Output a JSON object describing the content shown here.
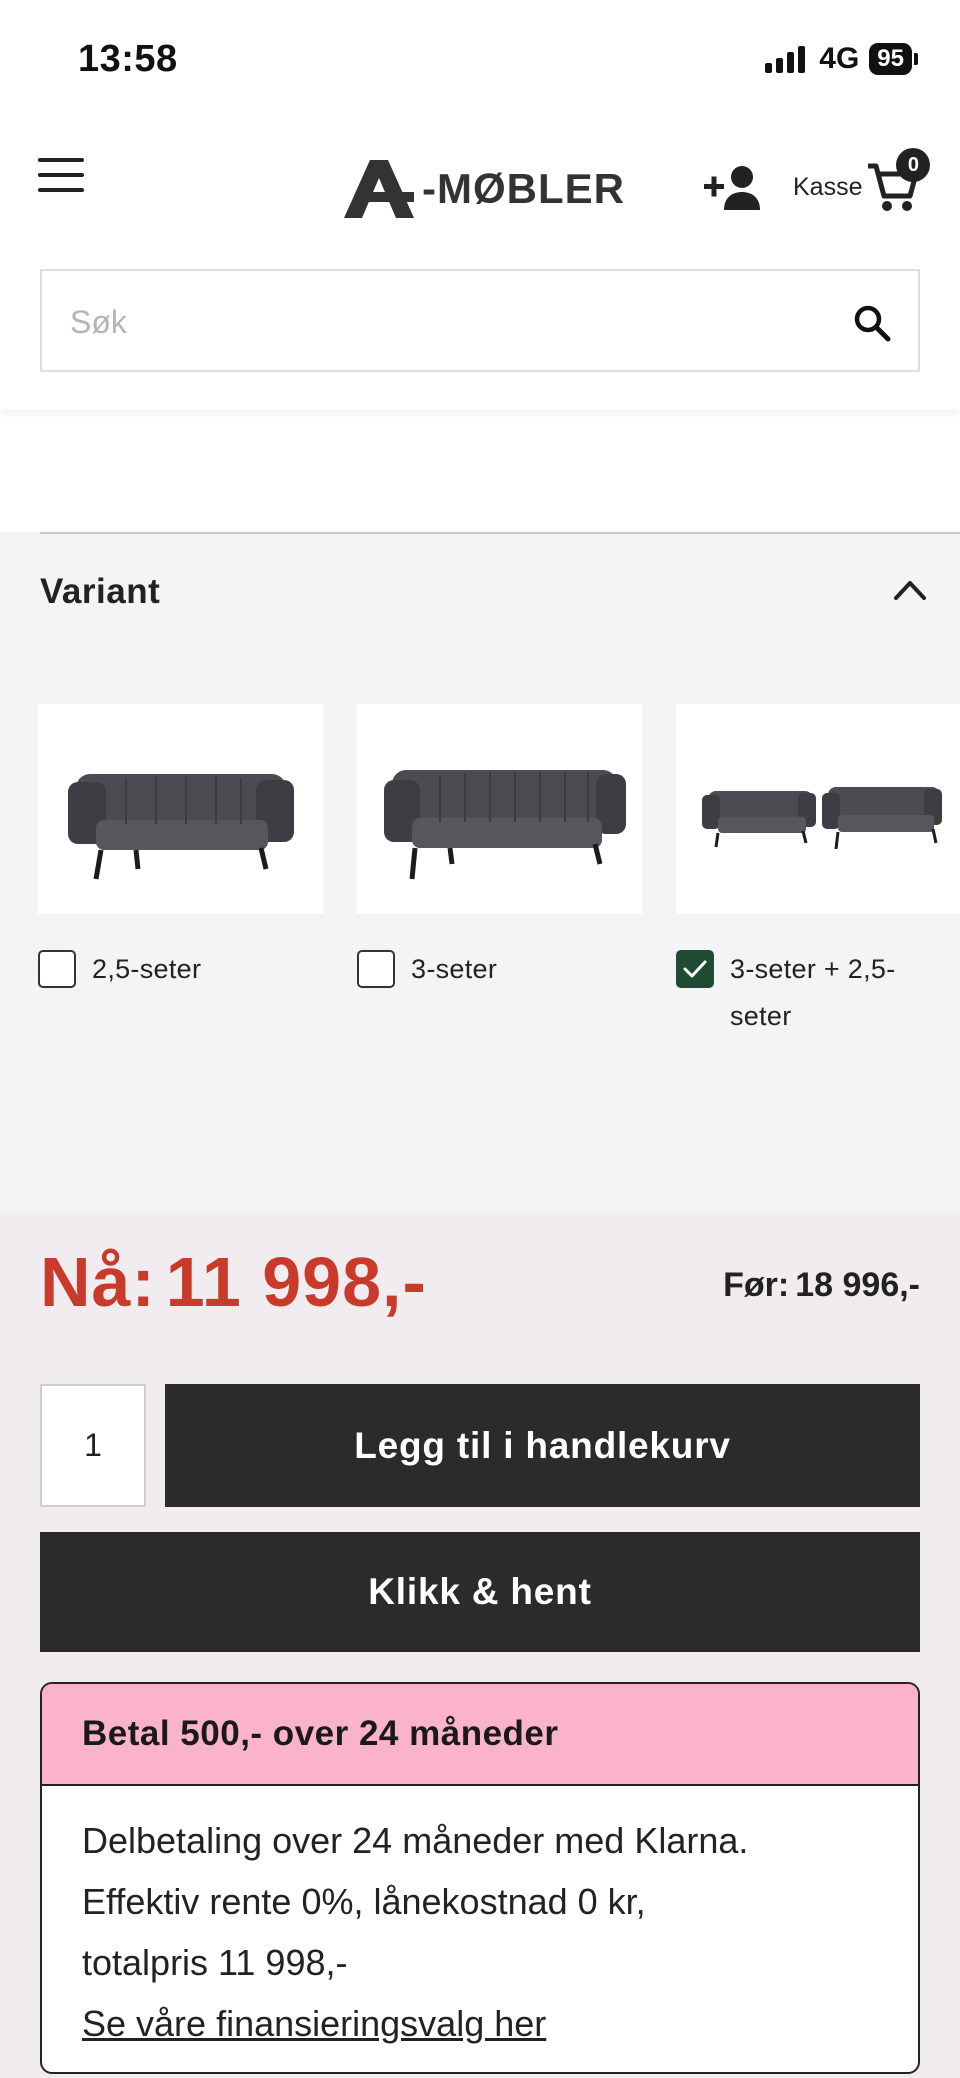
{
  "status_bar": {
    "time": "13:58",
    "network": "4G",
    "battery": "95"
  },
  "header": {
    "logo_text": "-MØBLER",
    "cart_label": "Kasse",
    "cart_count": "0"
  },
  "search": {
    "placeholder": "Søk"
  },
  "variant": {
    "title": "Variant",
    "options": [
      {
        "label": "2,5-seter",
        "checked": false
      },
      {
        "label": "3-seter",
        "checked": false
      },
      {
        "label": "3-seter + 2,5-",
        "label_line2": "seter",
        "checked": true
      }
    ]
  },
  "price": {
    "now_label": "Nå:",
    "now_value": "11 998,-",
    "before_label": "Før:",
    "before_value": "18 996,-"
  },
  "cart_form": {
    "quantity": "1",
    "add_to_cart": "Legg til i handlekurv",
    "click_collect": "Klikk & hent"
  },
  "klarna": {
    "heading": "Betal 500,- over 24 måneder",
    "line1": "Delbetaling over 24 måneder med Klarna.",
    "line2": "Effektiv rente 0%, lånekostnad 0 kr,",
    "line3": "totalpris 11 998,-",
    "link": "Se våre finansieringsvalg her"
  },
  "colors": {
    "price_red": "#c93a2a",
    "button_dark": "#2b2b2b",
    "klarna_pink": "#fbb3c9",
    "checkbox_green": "#1f4a33"
  }
}
